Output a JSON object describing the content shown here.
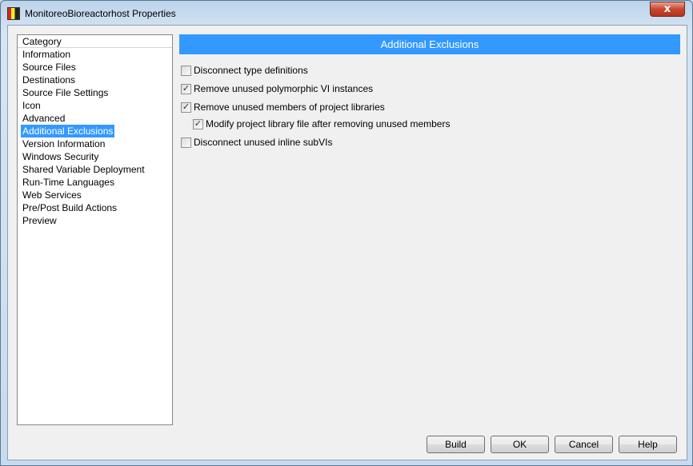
{
  "window": {
    "title": "MonitoreoBioreactorhost Properties",
    "close_label": "x"
  },
  "category": {
    "header": "Category",
    "items": [
      "Information",
      "Source Files",
      "Destinations",
      "Source File Settings",
      "Icon",
      "Advanced",
      "Additional Exclusions",
      "Version Information",
      "Windows Security",
      "Shared Variable Deployment",
      "Run-Time Languages",
      "Web Services",
      "Pre/Post Build Actions",
      "Preview"
    ],
    "selected": "Additional Exclusions"
  },
  "panel": {
    "title": "Additional Exclusions",
    "options": [
      {
        "label": "Disconnect type definitions",
        "checked": false
      },
      {
        "label": "Remove unused polymorphic VI instances",
        "checked": true
      },
      {
        "label": "Remove unused members of project libraries",
        "checked": true
      },
      {
        "label": "Modify project library file after removing unused members",
        "checked": true
      },
      {
        "label": "Disconnect unused inline subVIs",
        "checked": false
      }
    ]
  },
  "buttons": {
    "build": "Build",
    "ok": "OK",
    "cancel": "Cancel",
    "help": "Help"
  },
  "colors": {
    "accent": "#3399ff"
  }
}
